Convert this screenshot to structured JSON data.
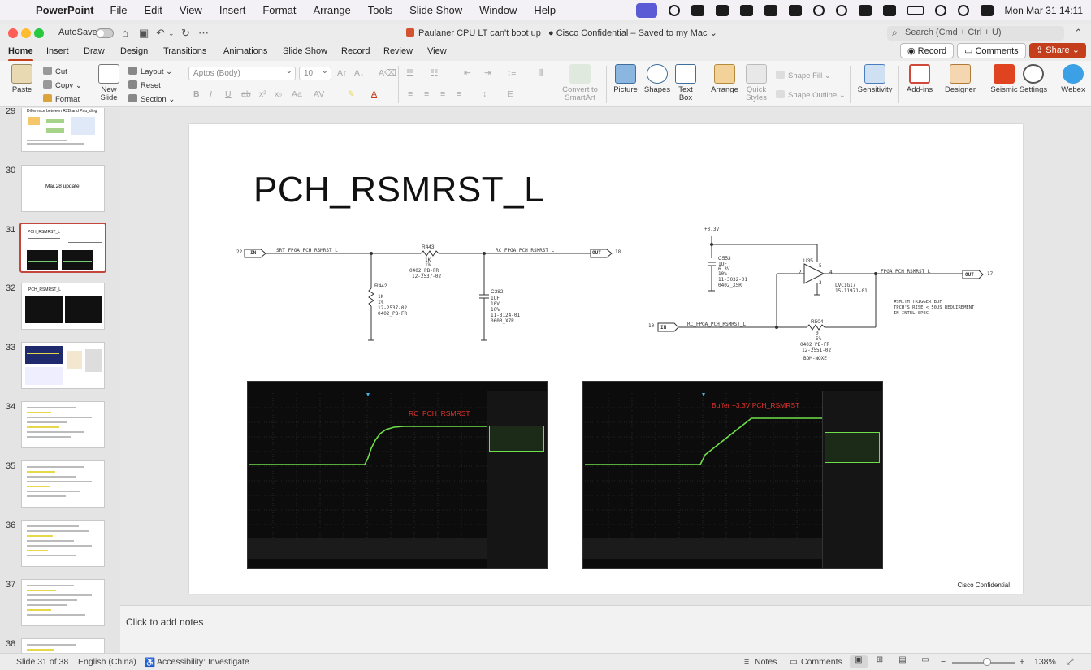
{
  "menubar": {
    "app_name": "PowerPoint",
    "items": [
      "File",
      "Edit",
      "View",
      "Insert",
      "Format",
      "Arrange",
      "Tools",
      "Slide Show",
      "Window",
      "Help"
    ],
    "clock": "Mon Mar 31  14:11"
  },
  "titlebar": {
    "autosave": "AutoSave",
    "doc_title": "Paulaner CPU LT can't boot up",
    "label": "Cisco Confidential – Saved to my Mac",
    "search_placeholder": "Search (Cmd + Ctrl + U)"
  },
  "ribbon_tabs": {
    "items": [
      "Home",
      "Insert",
      "Draw",
      "Design",
      "Transitions",
      "Animations",
      "Slide Show",
      "Record",
      "Review",
      "View"
    ],
    "active": "Home",
    "record": "Record",
    "comments": "Comments",
    "share": "Share"
  },
  "ribbon": {
    "paste": "Paste",
    "cut": "Cut",
    "copy": "Copy",
    "format": "Format",
    "new_slide": "New\nSlide",
    "layout": "Layout",
    "reset": "Reset",
    "section": "Section",
    "font": "Aptos (Body)",
    "font_size": "10",
    "convert_smartart": "Convert to\nSmartArt",
    "picture": "Picture",
    "shapes": "Shapes",
    "text_box": "Text\nBox",
    "arrange": "Arrange",
    "quick_styles": "Quick\nStyles",
    "shape_fill": "Shape Fill",
    "shape_outline": "Shape Outline",
    "sensitivity": "Sensitivity",
    "add_ins": "Add-ins",
    "designer": "Designer",
    "seismic": "Seismic",
    "settings": "Settings",
    "webex": "Webex"
  },
  "thumbnails": [
    {
      "num": "29",
      "title": "Difference between R2B and Pau_ding"
    },
    {
      "num": "30",
      "title": "Mar.28 update"
    },
    {
      "num": "31",
      "title": "PCH_RSMRST_L",
      "selected": true
    },
    {
      "num": "32",
      "title": "PCH_RSMRST_L"
    },
    {
      "num": "33",
      "title": ""
    },
    {
      "num": "34",
      "title": ""
    },
    {
      "num": "35",
      "title": ""
    },
    {
      "num": "36",
      "title": ""
    },
    {
      "num": "37",
      "title": ""
    },
    {
      "num": "38",
      "title": ""
    }
  ],
  "slide": {
    "title": "PCH_RSMRST_L",
    "footer": "Cisco Confidential",
    "schematic_left": {
      "in_pin": "22",
      "in_label": "IN",
      "net_in": "SRT_FPGA_PCH_RSMRST_L",
      "r443": "R443",
      "r443_val": "1K",
      "r443_tol": "1%",
      "r443_pkg": "0402_PB-FR",
      "r443_pn": "12-2537-02",
      "net_out": "RC_FPGA_PCH_RSMRST_L",
      "out_label": "OUT",
      "out_pin": "18",
      "r442": "R442",
      "r442_val": "1K",
      "r442_tol": "1%",
      "r442_pn": "12-2537-02",
      "r442_pkg": "0402_PB-FR",
      "c382": "C382",
      "c382_val": "1UF",
      "c382_v": "10V",
      "c382_tol": "10%",
      "c382_pn": "11-3124-01",
      "c382_pkg": "0603_X7R"
    },
    "schematic_right": {
      "rail": "+3.3V",
      "c553": "C553",
      "c553_val": "1UF",
      "c553_v": "6.3V",
      "c553_tol": "10%",
      "c553_pn": "11-3032-01",
      "c553_pkg": "0402_X5R",
      "u35": "U35",
      "u35_part": "LVC1G17",
      "u35_pn": "15-11971-01",
      "pin5": "5",
      "pin2": "2",
      "pin4": "4",
      "pin3": "3",
      "net_out": "FPGA_PCH_RSMRST_L",
      "out_label": "OUT",
      "out_pin": "17",
      "note1": "#SMITH TRIGGER BUF",
      "note2": "TPCH'S RISE < 50US REQUIREMENT",
      "note3": "IN INTEL SPEC",
      "in_pin": "10",
      "in_label": "IN",
      "net_in": "RC_FPGA_PCH_RSMRST_L",
      "r504": "R504",
      "r504_val": "0",
      "r504_tol": "5%",
      "r504_pkg": "0402_PB-FR",
      "r504_pn": "12-2551-02",
      "r504_note": "BOM-NOXE"
    },
    "scope1_label": "RC_PCH_RSMRST",
    "scope2_label": "Buffer +3.3V PCH_RSMRST"
  },
  "notes": {
    "placeholder": "Click to add notes"
  },
  "status": {
    "slide_of": "Slide 31 of 38",
    "language": "English (China)",
    "accessibility": "Accessibility: Investigate",
    "notes": "Notes",
    "comments": "Comments",
    "zoom": "138%"
  },
  "colors": {
    "accent": "#c43e1c",
    "trace": "#6ee04a",
    "selected_thumb": "#c4463a"
  }
}
